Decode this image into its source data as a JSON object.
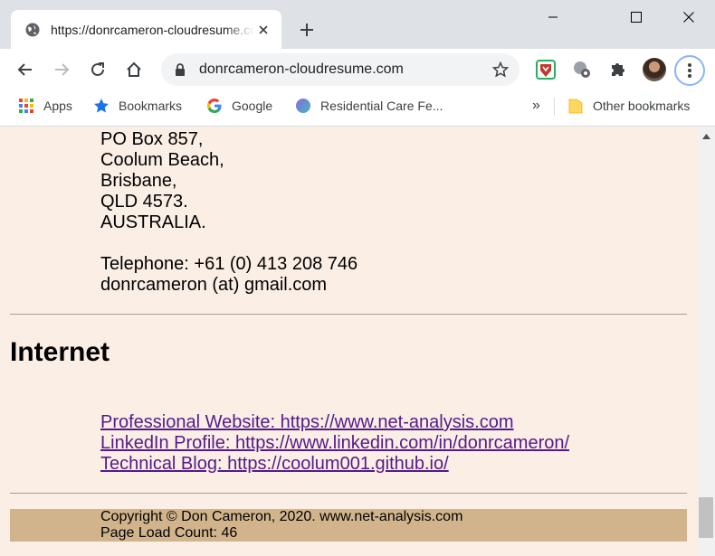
{
  "window": {
    "tab_title": "https://donrcameron-cloudresume.com",
    "new_tab_symbol": "+",
    "minimize_icon": "minimize-icon",
    "maximize_icon": "maximize-icon",
    "close_icon": "close-icon"
  },
  "toolbar": {
    "url": "donrcameron-cloudresume.com"
  },
  "bookmarks": {
    "items": [
      {
        "label": "Apps",
        "icon": "apps-grid-icon"
      },
      {
        "label": "Bookmarks",
        "icon": "star-icon"
      },
      {
        "label": "Google",
        "icon": "google-icon"
      },
      {
        "label": "Residential Care Fe...",
        "icon": "globe-icon"
      }
    ],
    "overflow": "»",
    "other": "Other bookmarks"
  },
  "page": {
    "address_lines": [
      "PO Box 857,",
      "Coolum Beach,",
      "Brisbane,",
      "QLD 4573.",
      "AUSTRALIA."
    ],
    "telephone": "Telephone: +61 (0) 413 208 746",
    "email": "donrcameron (at) gmail.com",
    "internet_heading": "Internet",
    "links": [
      "Professional Website: https://www.net-analysis.com",
      "LinkedIn Profile: https://www.linkedin.com/in/donrcameron/",
      "Technical Blog: https://coolum001.github.io/"
    ],
    "footer_copyright": "Copyright © Don Cameron, 2020. www.net-analysis.com",
    "footer_count": "Page Load Count: 46"
  },
  "colors": {
    "page_bg": "#faeee5",
    "footer_bg": "#d2b48c",
    "link": "#551a8b"
  }
}
